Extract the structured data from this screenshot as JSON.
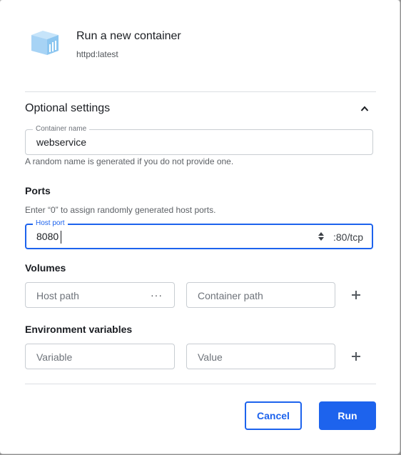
{
  "header": {
    "title": "Run a new container",
    "image": "httpd:latest",
    "logo_icon": "container-icon"
  },
  "optional_settings": {
    "title": "Optional settings",
    "expanded": true,
    "collapse_icon": "chevron-up-icon"
  },
  "container_name": {
    "label": "Container name",
    "value": "webservice",
    "helper": "A random name is generated if you do not provide one."
  },
  "ports": {
    "title": "Ports",
    "helper": "Enter “0” to assign randomly generated host ports.",
    "host_port_label": "Host port",
    "host_port_value": "8080",
    "container_port": ":80/tcp"
  },
  "volumes": {
    "title": "Volumes",
    "host_path_placeholder": "Host path",
    "browse_label": "···",
    "container_path_placeholder": "Container path"
  },
  "env": {
    "title": "Environment variables",
    "variable_placeholder": "Variable",
    "value_placeholder": "Value"
  },
  "actions": {
    "cancel": "Cancel",
    "run": "Run"
  },
  "colors": {
    "accent": "#1d63ed",
    "logo": "#9fd0f5"
  }
}
